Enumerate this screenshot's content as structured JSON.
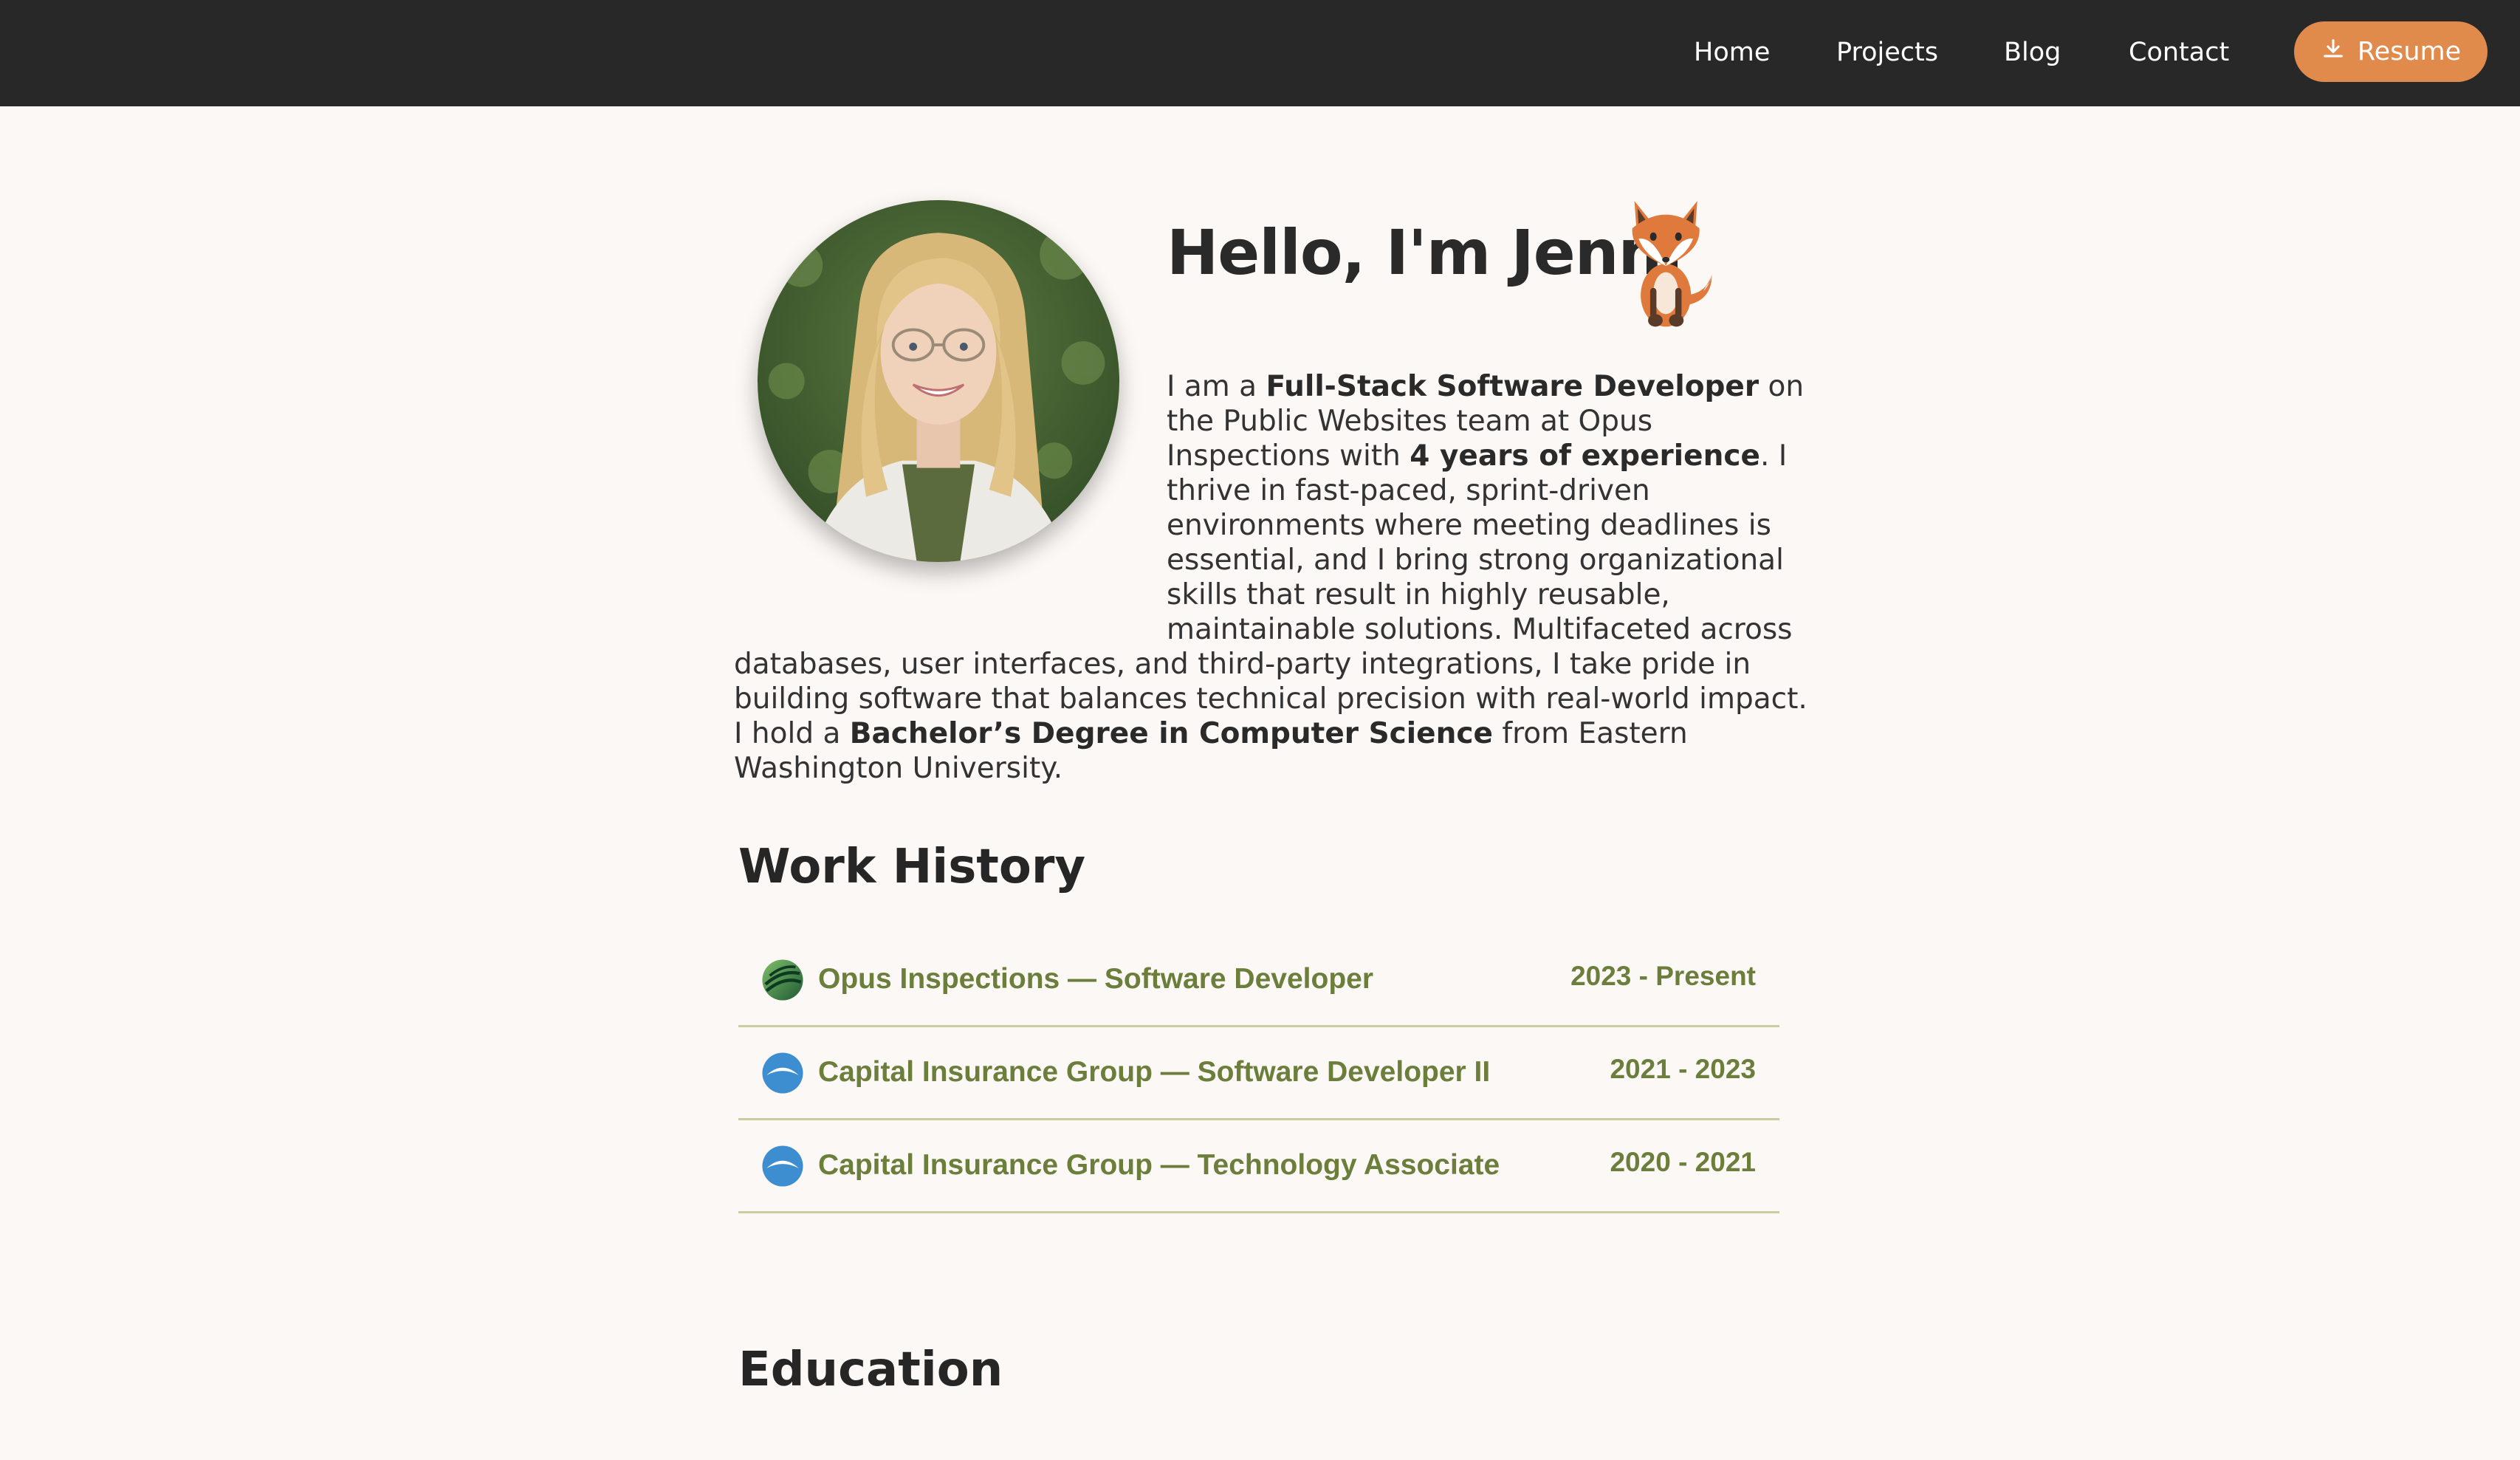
{
  "nav": {
    "links": [
      "Home",
      "Projects",
      "Blog",
      "Contact"
    ],
    "resume_label": "Resume",
    "resume_icon": "download-icon"
  },
  "hero": {
    "greeting": "Hello, I'm Jenni",
    "mascot_icon": "fox-icon",
    "bio": {
      "p1": "I am a ",
      "b1": "Full-Stack Software Developer",
      "p2": " on the Public Websites team at Opus Inspections with ",
      "b2": "4 years of experience",
      "p3": ". I thrive in fast-paced, sprint-driven environments where meeting deadlines is essential, and I bring strong organizational skills that result in highly reusable, maintainable solutions. Multifaceted across databases, user interfaces, and third-party integrations, I take pride in building software that balances technical precision with real-world impact. I hold a ",
      "b3": "Bachelor’s Degree in Computer Science",
      "p4": " from Eastern Washington University."
    }
  },
  "work_history": {
    "heading": "Work History",
    "items": [
      {
        "title": "Opus Inspections — Software Developer",
        "dates": "2023 - Present",
        "logo": "opus-logo-icon"
      },
      {
        "title": "Capital Insurance Group — Software Developer II",
        "dates": "2021 - 2023",
        "logo": "cig-logo-icon"
      },
      {
        "title": "Capital Insurance Group — Technology Associate",
        "dates": "2020 - 2021",
        "logo": "cig-logo-icon"
      }
    ]
  },
  "education": {
    "heading": "Education"
  },
  "colors": {
    "nav_bg": "#282828",
    "accent": "#e08a4c",
    "page_bg": "#fcf8f5",
    "work_text": "#6b7e3c",
    "divider": "#c7cfa1"
  }
}
